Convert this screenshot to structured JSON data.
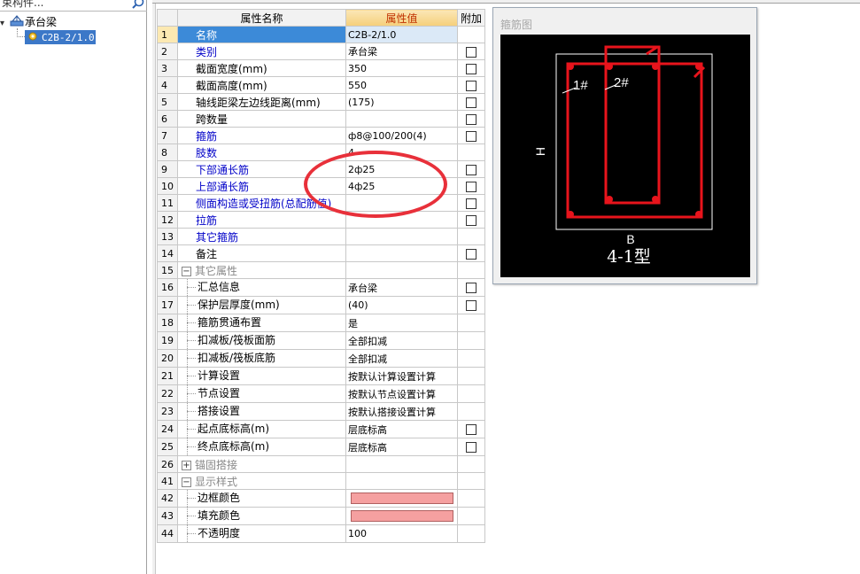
{
  "left_panel": {
    "search_text": "束构件...",
    "tree_root_label": "承台梁",
    "tree_child_label": "C2B-2/1.0"
  },
  "grid": {
    "header": {
      "name": "属性名称",
      "value": "属性值",
      "extra": "附加"
    },
    "rows": [
      {
        "num": "1",
        "name": "名称",
        "value": "C2B-2/1.0",
        "color": "blue",
        "checkbox": false,
        "selected": true
      },
      {
        "num": "2",
        "name": "类别",
        "value": "承台梁",
        "color": "blue",
        "checkbox": true
      },
      {
        "num": "3",
        "name": "截面宽度(mm)",
        "value": "350",
        "color": "black",
        "checkbox": true
      },
      {
        "num": "4",
        "name": "截面高度(mm)",
        "value": "550",
        "color": "black",
        "checkbox": true
      },
      {
        "num": "5",
        "name": "轴线距梁左边线距离(mm)",
        "value": "(175)",
        "color": "black",
        "checkbox": true
      },
      {
        "num": "6",
        "name": "跨数量",
        "value": "",
        "color": "black",
        "checkbox": true
      },
      {
        "num": "7",
        "name": "箍筋",
        "value": "ф8@100/200(4)",
        "color": "blue",
        "checkbox": true
      },
      {
        "num": "8",
        "name": "肢数",
        "value": "4",
        "color": "blue",
        "checkbox": false
      },
      {
        "num": "9",
        "name": "下部通长筋",
        "value": "2ф25",
        "color": "blue",
        "checkbox": true
      },
      {
        "num": "10",
        "name": "上部通长筋",
        "value": "4ф25",
        "color": "blue",
        "checkbox": true
      },
      {
        "num": "11",
        "name": "侧面构造或受扭筋(总配筋值)",
        "value": "",
        "color": "blue",
        "checkbox": true
      },
      {
        "num": "12",
        "name": "拉筋",
        "value": "",
        "color": "blue",
        "checkbox": true
      },
      {
        "num": "13",
        "name": "其它箍筋",
        "value": "",
        "color": "blue",
        "checkbox": false
      },
      {
        "num": "14",
        "name": "备注",
        "value": "",
        "color": "black",
        "checkbox": true
      },
      {
        "num": "15",
        "name": "其它属性",
        "value": "",
        "color": "grey",
        "checkbox": false,
        "group": "−"
      },
      {
        "num": "16",
        "name": "汇总信息",
        "value": "承台梁",
        "color": "black",
        "checkbox": true,
        "indent": true
      },
      {
        "num": "17",
        "name": "保护层厚度(mm)",
        "value": "(40)",
        "color": "black",
        "checkbox": true,
        "indent": true
      },
      {
        "num": "18",
        "name": "箍筋贯通布置",
        "value": "是",
        "color": "black",
        "checkbox": false,
        "indent": true
      },
      {
        "num": "19",
        "name": "扣减板/筏板面筋",
        "value": "全部扣减",
        "color": "black",
        "checkbox": false,
        "indent": true
      },
      {
        "num": "20",
        "name": "扣减板/筏板底筋",
        "value": "全部扣减",
        "color": "black",
        "checkbox": false,
        "indent": true
      },
      {
        "num": "21",
        "name": "计算设置",
        "value": "按默认计算设置计算",
        "color": "black",
        "checkbox": false,
        "indent": true
      },
      {
        "num": "22",
        "name": "节点设置",
        "value": "按默认节点设置计算",
        "color": "black",
        "checkbox": false,
        "indent": true
      },
      {
        "num": "23",
        "name": "搭接设置",
        "value": "按默认搭接设置计算",
        "color": "black",
        "checkbox": false,
        "indent": true
      },
      {
        "num": "24",
        "name": "起点底标高(m)",
        "value": "层底标高",
        "color": "black",
        "checkbox": true,
        "indent": true
      },
      {
        "num": "25",
        "name": "终点底标高(m)",
        "value": "层底标高",
        "color": "black",
        "checkbox": true,
        "indent": true
      },
      {
        "num": "26",
        "name": "锚固搭接",
        "value": "",
        "color": "grey",
        "checkbox": false,
        "group": "+"
      },
      {
        "num": "41",
        "name": "显示样式",
        "value": "",
        "color": "grey",
        "checkbox": false,
        "group": "−"
      },
      {
        "num": "42",
        "name": "边框颜色",
        "value": "",
        "color": "black",
        "checkbox": false,
        "indent": true,
        "swatch": true
      },
      {
        "num": "43",
        "name": "填充颜色",
        "value": "",
        "color": "black",
        "checkbox": false,
        "indent": true,
        "swatch": true
      },
      {
        "num": "44",
        "name": "不透明度",
        "value": "100",
        "color": "black",
        "checkbox": false,
        "indent": true
      }
    ]
  },
  "diagram": {
    "title": "箍筋图",
    "label_1": "1#",
    "label_2": "2#",
    "label_h": "H",
    "label_b": "B",
    "type_label": "4-1型"
  },
  "colors": {
    "rebar": "#e8141c",
    "annotation": "#e8303a",
    "swatch": "#f5a0a0",
    "selected_row": "#3c8ad8",
    "value_header": "#f5cf7a"
  }
}
